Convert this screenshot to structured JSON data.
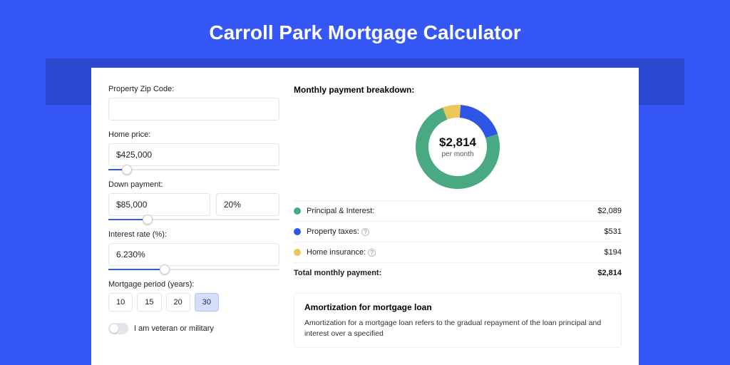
{
  "title": "Carroll Park Mortgage Calculator",
  "form": {
    "zip": {
      "label": "Property Zip Code:",
      "value": ""
    },
    "home_price": {
      "label": "Home price:",
      "value": "$425,000",
      "slider_pct": 8
    },
    "down_payment": {
      "label": "Down payment:",
      "amount": "$85,000",
      "pct": "20%",
      "slider_pct": 20
    },
    "interest": {
      "label": "Interest rate (%):",
      "value": "6.230%",
      "slider_pct": 30
    },
    "period": {
      "label": "Mortgage period (years):",
      "options": [
        "10",
        "15",
        "20",
        "30"
      ],
      "selected": "30"
    },
    "veteran": {
      "label": "I am veteran or military",
      "on": false
    }
  },
  "breakdown": {
    "title": "Monthly payment breakdown:",
    "center_value": "$2,814",
    "center_sub": "per month",
    "rows": [
      {
        "color": "green",
        "label": "Principal & Interest:",
        "value": "$2,089",
        "info": false
      },
      {
        "color": "blue",
        "label": "Property taxes:",
        "value": "$531",
        "info": true
      },
      {
        "color": "gold",
        "label": "Home insurance:",
        "value": "$194",
        "info": true
      }
    ],
    "total_label": "Total monthly payment:",
    "total_value": "$2,814"
  },
  "chart_data": {
    "type": "pie",
    "title": "Monthly payment breakdown",
    "series": [
      {
        "name": "Principal & Interest",
        "value": 2089,
        "color": "#49a983"
      },
      {
        "name": "Property taxes",
        "value": 531,
        "color": "#2f55e6"
      },
      {
        "name": "Home insurance",
        "value": 194,
        "color": "#e9c758"
      }
    ],
    "total": 2814,
    "center_label": "$2,814 per month"
  },
  "amort": {
    "title": "Amortization for mortgage loan",
    "text": "Amortization for a mortgage loan refers to the gradual repayment of the loan principal and interest over a specified"
  }
}
